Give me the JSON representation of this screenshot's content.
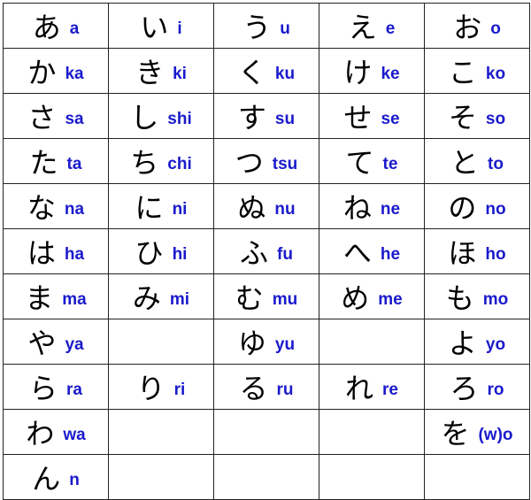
{
  "colors": {
    "kana": "#000000",
    "romaji": "#1a1acc",
    "grid": "#222222"
  },
  "rows": [
    [
      [
        "あ",
        "a"
      ],
      [
        "い",
        "i"
      ],
      [
        "う",
        "u"
      ],
      [
        "え",
        "e"
      ],
      [
        "お",
        "o"
      ]
    ],
    [
      [
        "か",
        "ka"
      ],
      [
        "き",
        "ki"
      ],
      [
        "く",
        "ku"
      ],
      [
        "け",
        "ke"
      ],
      [
        "こ",
        "ko"
      ]
    ],
    [
      [
        "さ",
        "sa"
      ],
      [
        "し",
        "shi"
      ],
      [
        "す",
        "su"
      ],
      [
        "せ",
        "se"
      ],
      [
        "そ",
        "so"
      ]
    ],
    [
      [
        "た",
        "ta"
      ],
      [
        "ち",
        "chi"
      ],
      [
        "つ",
        "tsu"
      ],
      [
        "て",
        "te"
      ],
      [
        "と",
        "to"
      ]
    ],
    [
      [
        "な",
        "na"
      ],
      [
        "に",
        "ni"
      ],
      [
        "ぬ",
        "nu"
      ],
      [
        "ね",
        "ne"
      ],
      [
        "の",
        "no"
      ]
    ],
    [
      [
        "は",
        "ha"
      ],
      [
        "ひ",
        "hi"
      ],
      [
        "ふ",
        "fu"
      ],
      [
        "へ",
        "he"
      ],
      [
        "ほ",
        "ho"
      ]
    ],
    [
      [
        "ま",
        "ma"
      ],
      [
        "み",
        "mi"
      ],
      [
        "む",
        "mu"
      ],
      [
        "め",
        "me"
      ],
      [
        "も",
        "mo"
      ]
    ],
    [
      [
        "や",
        "ya"
      ],
      null,
      [
        "ゆ",
        "yu"
      ],
      null,
      [
        "よ",
        "yo"
      ]
    ],
    [
      [
        "ら",
        "ra"
      ],
      [
        "り",
        "ri"
      ],
      [
        "る",
        "ru"
      ],
      [
        "れ",
        "re"
      ],
      [
        "ろ",
        "ro"
      ]
    ],
    [
      [
        "わ",
        "wa"
      ],
      null,
      null,
      null,
      [
        "を",
        "(w)o"
      ]
    ],
    [
      [
        "ん",
        "n"
      ],
      null,
      null,
      null,
      null
    ]
  ]
}
